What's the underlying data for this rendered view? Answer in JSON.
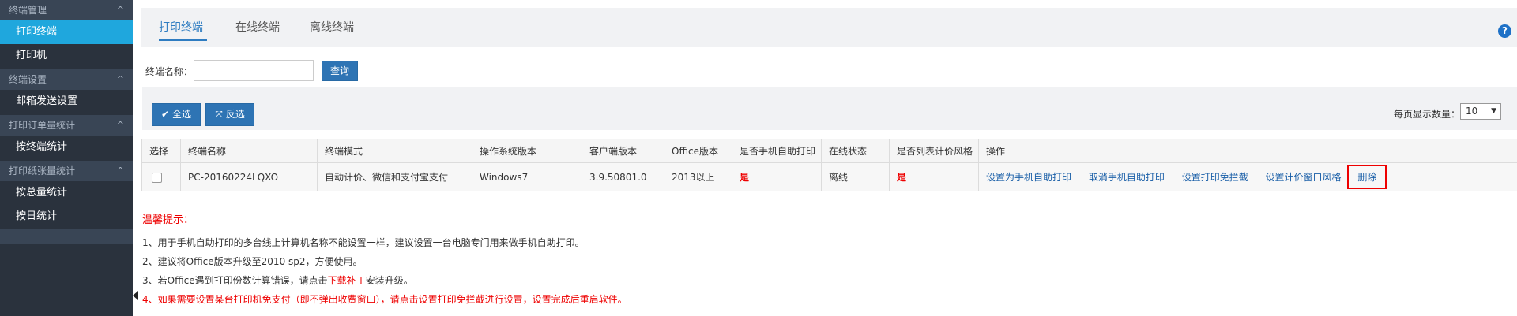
{
  "sidebar": {
    "groups": [
      {
        "title": "终端管理",
        "items": [
          {
            "label": "打印终端",
            "active": true
          },
          {
            "label": "打印机",
            "active": false
          }
        ]
      },
      {
        "title": "终端设置",
        "items": [
          {
            "label": "邮箱发送设置",
            "active": false
          }
        ]
      },
      {
        "title": "打印订单量统计",
        "items": [
          {
            "label": "按终端统计",
            "active": false
          }
        ]
      },
      {
        "title": "打印纸张量统计",
        "items": [
          {
            "label": "按总量统计",
            "active": false
          },
          {
            "label": "按日统计",
            "active": false
          }
        ]
      }
    ],
    "chevron": "^"
  },
  "tabs": [
    {
      "label": "打印终端",
      "active": true
    },
    {
      "label": "在线终端",
      "active": false
    },
    {
      "label": "离线终端",
      "active": false
    }
  ],
  "help_icon": "?",
  "search": {
    "label": "终端名称：",
    "value": "",
    "placeholder": "",
    "button": "查询"
  },
  "toolbar": {
    "select_all": "全选",
    "invert": "反选",
    "per_page_label": "每页显示数量：",
    "per_page_value": "10"
  },
  "table": {
    "headers": [
      "选择",
      "终端名称",
      "终端模式",
      "操作系统版本",
      "客户端版本",
      "Office版本",
      "是否手机自助打印",
      "在线状态",
      "是否列表计价风格",
      "操作"
    ],
    "rows": [
      {
        "name": "PC-20160224LQXO",
        "mode": "自动计价、微信和支付宝支付",
        "os": "Windows7",
        "client": "3.9.50801.0",
        "office": "2013以上",
        "mobile_print": "是",
        "status": "离线",
        "list_price": "是",
        "actions": [
          "设置为手机自助打印",
          "取消手机自助打印",
          "设置打印免拦截",
          "设置计价窗口风格"
        ],
        "delete": "删除"
      }
    ]
  },
  "tips": {
    "title": "温馨提示：",
    "line1": "1、用于手机自助打印的多台线上计算机名称不能设置一样，建议设置一台电脑专门用来做手机自助打印。",
    "line2": "2、建议将Office版本升级至2010 sp2，方便使用。",
    "line3_pre": "3、若Office遇到打印份数计算错误，请点击",
    "line3_link": "下载补丁",
    "line3_post": "安装升级。",
    "line4": "4、如果需要设置某台打印机免支付（即不弹出收费窗口），请点击设置打印免拦截进行设置，设置完成后重启软件。"
  },
  "colors": {
    "accent": "#1fa7dd",
    "primary": "#2e74b4",
    "sidebar": "#394555",
    "warning": "#ee0000"
  }
}
